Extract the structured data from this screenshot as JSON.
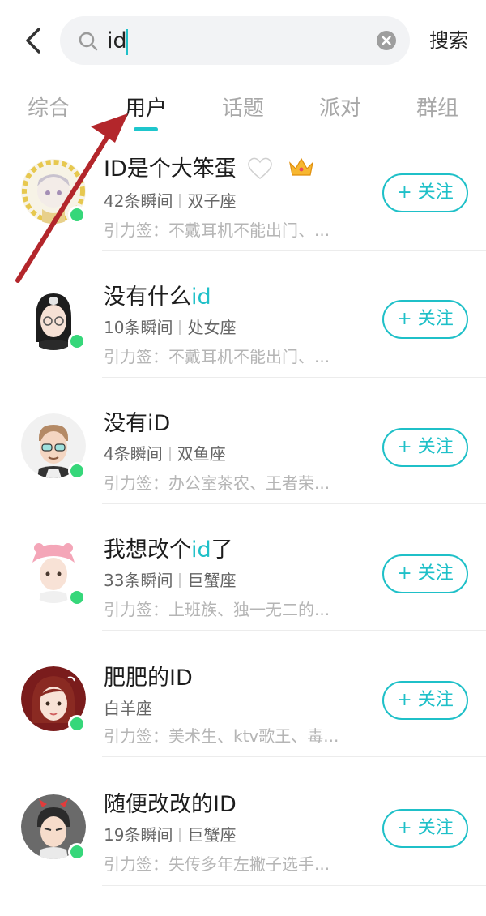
{
  "search": {
    "value": "id",
    "button_label": "搜索"
  },
  "tabs": [
    {
      "label": "综合",
      "active": false
    },
    {
      "label": "用户",
      "active": true
    },
    {
      "label": "话题",
      "active": false
    },
    {
      "label": "派对",
      "active": false
    },
    {
      "label": "群组",
      "active": false
    }
  ],
  "users": [
    {
      "name_pre": "ID是个大笨蛋",
      "name_hl": "",
      "name_post": "",
      "badges": [
        "white-heart-emoji",
        "crown-emoji"
      ],
      "moments": "42条瞬间",
      "zodiac": "双子座",
      "tags": "引力签：不戴耳机不能出门、...",
      "follow": "+ 关注",
      "online": true
    },
    {
      "name_pre": "没有什么",
      "name_hl": "id",
      "name_post": "",
      "badges": [],
      "moments": "10条瞬间",
      "zodiac": "处女座",
      "tags": "引力签：不戴耳机不能出门、...",
      "follow": "+ 关注",
      "online": true
    },
    {
      "name_pre": "没有iD",
      "name_hl": "",
      "name_post": "",
      "badges": [],
      "moments": "4条瞬间",
      "zodiac": "双鱼座",
      "tags": "引力签：办公室茶农、王者荣...",
      "follow": "+ 关注",
      "online": true
    },
    {
      "name_pre": "我想改个",
      "name_hl": "id",
      "name_post": "了",
      "badges": [],
      "moments": "33条瞬间",
      "zodiac": "巨蟹座",
      "tags": "引力签：上班族、独一无二的...",
      "follow": "+ 关注",
      "online": true
    },
    {
      "name_pre": "肥肥的ID",
      "name_hl": "",
      "name_post": "",
      "badges": [],
      "moments": "",
      "zodiac": "白羊座",
      "tags": "引力签：美术生、ktv歌王、毒...",
      "follow": "+ 关注",
      "online": true
    },
    {
      "name_pre": "随便改改的ID",
      "name_hl": "",
      "name_post": "",
      "badges": [],
      "moments": "19条瞬间",
      "zodiac": "巨蟹座",
      "tags": "引力签：失传多年左撇子选手...",
      "follow": "+ 关注",
      "online": true
    }
  ],
  "colors": {
    "accent": "#1fc0c8",
    "online": "#36d77a",
    "annotation_arrow": "#b3262b"
  }
}
